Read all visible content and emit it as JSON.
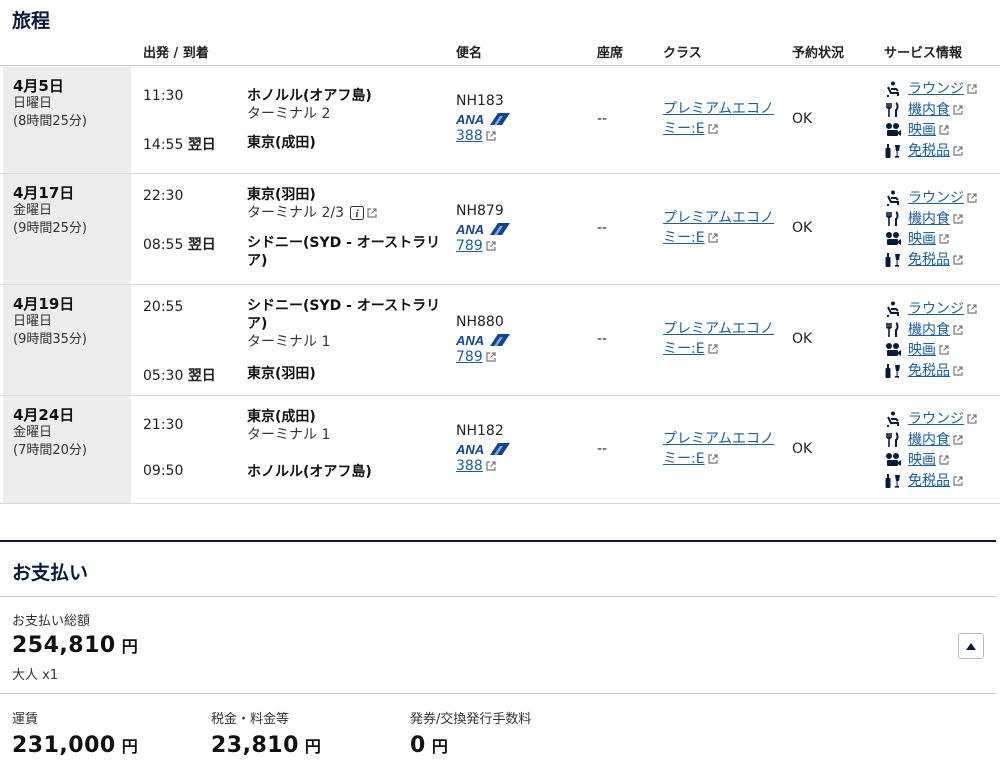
{
  "itinerary": {
    "title": "旅程",
    "headers": {
      "dep_arr": "出発 / 到着",
      "flight": "便名",
      "seat": "座席",
      "class": "クラス",
      "status": "予約状況",
      "services": "サービス情報"
    },
    "segments": [
      {
        "date": "4月5日",
        "dow": "日曜日",
        "duration": "(8時間25分)",
        "dep_time": "11:30",
        "dep_place": "ホノルル(オアフ島)",
        "dep_terminal": "ターミナル 2",
        "arr_time": "14:55",
        "arr_next": "翌日",
        "arr_place": "東京(成田)",
        "flight_no": "NH183",
        "aircraft": "388",
        "seat": "--",
        "class_label": "プレミアムエコノミー:E",
        "status": "OK"
      },
      {
        "date": "4月17日",
        "dow": "金曜日",
        "duration": "(9時間25分)",
        "dep_time": "22:30",
        "dep_place": "東京(羽田)",
        "dep_terminal": "ターミナル 2/3",
        "arr_time": "08:55",
        "arr_next": "翌日",
        "arr_place": "シドニー(SYD - オーストラリア)",
        "flight_no": "NH879",
        "aircraft": "789",
        "seat": "--",
        "class_label": "プレミアムエコノミー:E",
        "status": "OK"
      },
      {
        "date": "4月19日",
        "dow": "日曜日",
        "duration": "(9時間35分)",
        "dep_time": "20:55",
        "dep_place": "シドニー(SYD - オーストラリア)",
        "dep_terminal": "ターミナル 1",
        "arr_time": "05:30",
        "arr_next": "翌日",
        "arr_place": "東京(羽田)",
        "flight_no": "NH880",
        "aircraft": "789",
        "seat": "--",
        "class_label": "プレミアムエコノミー:E",
        "status": "OK"
      },
      {
        "date": "4月24日",
        "dow": "金曜日",
        "duration": "(7時間20分)",
        "dep_time": "21:30",
        "dep_place": "東京(成田)",
        "dep_terminal": "ターミナル 1",
        "arr_time": "09:50",
        "arr_next": "",
        "arr_place": "ホノルル(オアフ島)",
        "flight_no": "NH182",
        "aircraft": "388",
        "seat": "--",
        "class_label": "プレミアムエコノミー:E",
        "status": "OK"
      }
    ],
    "services": [
      "ラウンジ",
      "機内食",
      "映画",
      "免税品"
    ],
    "airline_logo_text": "ANA"
  },
  "payment": {
    "title": "お支払い",
    "total_label": "お支払い総額",
    "total_amount": "254,810",
    "currency": "円",
    "pax": "大人 x1",
    "fare_label": "運賃",
    "fare_amount": "231,000",
    "tax_label": "税金・料金等",
    "tax_amount": "23,810",
    "fee_label": "発券/交換発行手数料",
    "fee_amount": "0"
  },
  "colors": {
    "navy": "#0a1a3a",
    "link": "#1a5ea0",
    "ana_blue": "#13448f"
  }
}
